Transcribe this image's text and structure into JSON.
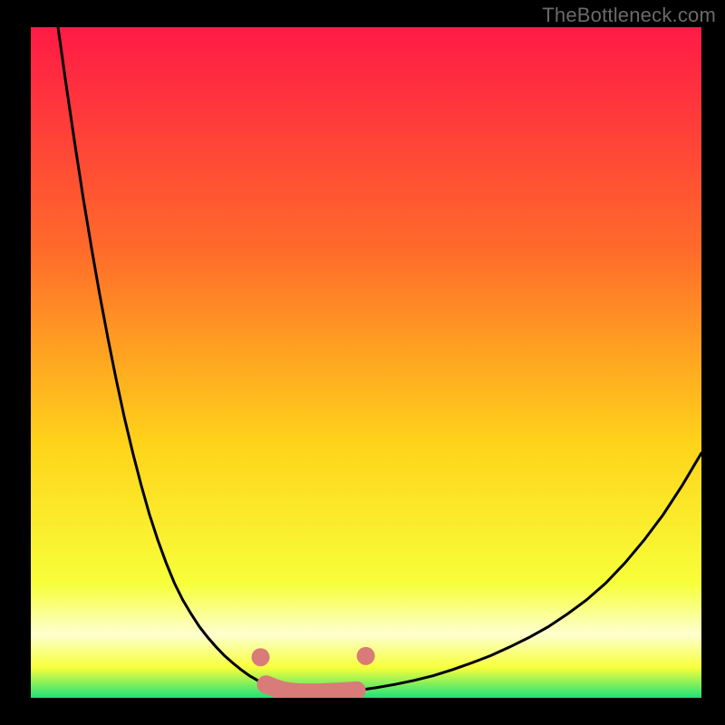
{
  "watermark": "TheBottleneck.com",
  "colors": {
    "grad_top": "#ff1a46",
    "grad_upper_mid": "#ff6a2a",
    "grad_mid": "#ffd31a",
    "grad_lower_mid": "#f7ff3a",
    "grad_band_pale": "#fdffcf",
    "grad_bottom": "#1de27a",
    "curve": "#000000",
    "marker": "#d97b78"
  },
  "chart_data": {
    "type": "line",
    "title": "",
    "xlabel": "",
    "ylabel": "",
    "xlim": [
      0,
      100
    ],
    "ylim": [
      0,
      100
    ],
    "grid": false,
    "legend": false,
    "x": [
      0,
      2,
      4,
      6,
      8,
      10,
      12,
      14,
      16,
      18,
      20,
      22,
      24,
      26,
      28,
      30,
      32,
      34,
      36,
      38,
      40,
      42,
      44,
      46,
      48,
      50,
      52,
      54,
      56,
      58,
      60,
      62,
      64,
      66,
      68,
      70,
      72,
      74,
      76,
      78,
      80,
      82,
      84,
      86,
      88,
      90,
      92,
      94,
      96,
      98,
      100
    ],
    "series": [
      {
        "name": "bottleneck-curve",
        "values": [
          100,
          91.2,
          82.8,
          74.8,
          67.3,
          60.2,
          53.6,
          47.4,
          41.7,
          36.5,
          31.7,
          27.3,
          23.5,
          20.1,
          17.1,
          14.6,
          12.5,
          10.6,
          9.0,
          7.6,
          6.3,
          5.2,
          4.2,
          3.3,
          2.6,
          2.0,
          1.5,
          1.1,
          0.9,
          0.8,
          0.8,
          0.9,
          1.1,
          1.5,
          2.0,
          2.6,
          3.3,
          4.2,
          5.2,
          6.3,
          7.6,
          9.0,
          10.6,
          12.5,
          14.6,
          17.1,
          20.1,
          23.5,
          27.3,
          31.7,
          36.5
        ]
      }
    ],
    "markers": {
      "name": "highlight-segment",
      "indices_from": 14,
      "indices_to": 21,
      "color_key": "marker"
    },
    "xmap_last_x_at_pixel_frac": 1.0,
    "gradient_stops": [
      {
        "offset": 0.0,
        "key": "grad_top"
      },
      {
        "offset": 0.33,
        "key": "grad_upper_mid"
      },
      {
        "offset": 0.62,
        "key": "grad_mid"
      },
      {
        "offset": 0.83,
        "key": "grad_lower_mid"
      },
      {
        "offset": 0.905,
        "key": "grad_band_pale"
      },
      {
        "offset": 0.955,
        "key": "grad_lower_mid"
      },
      {
        "offset": 1.0,
        "key": "grad_bottom"
      }
    ],
    "curve_min_center_x": 37.5
  }
}
